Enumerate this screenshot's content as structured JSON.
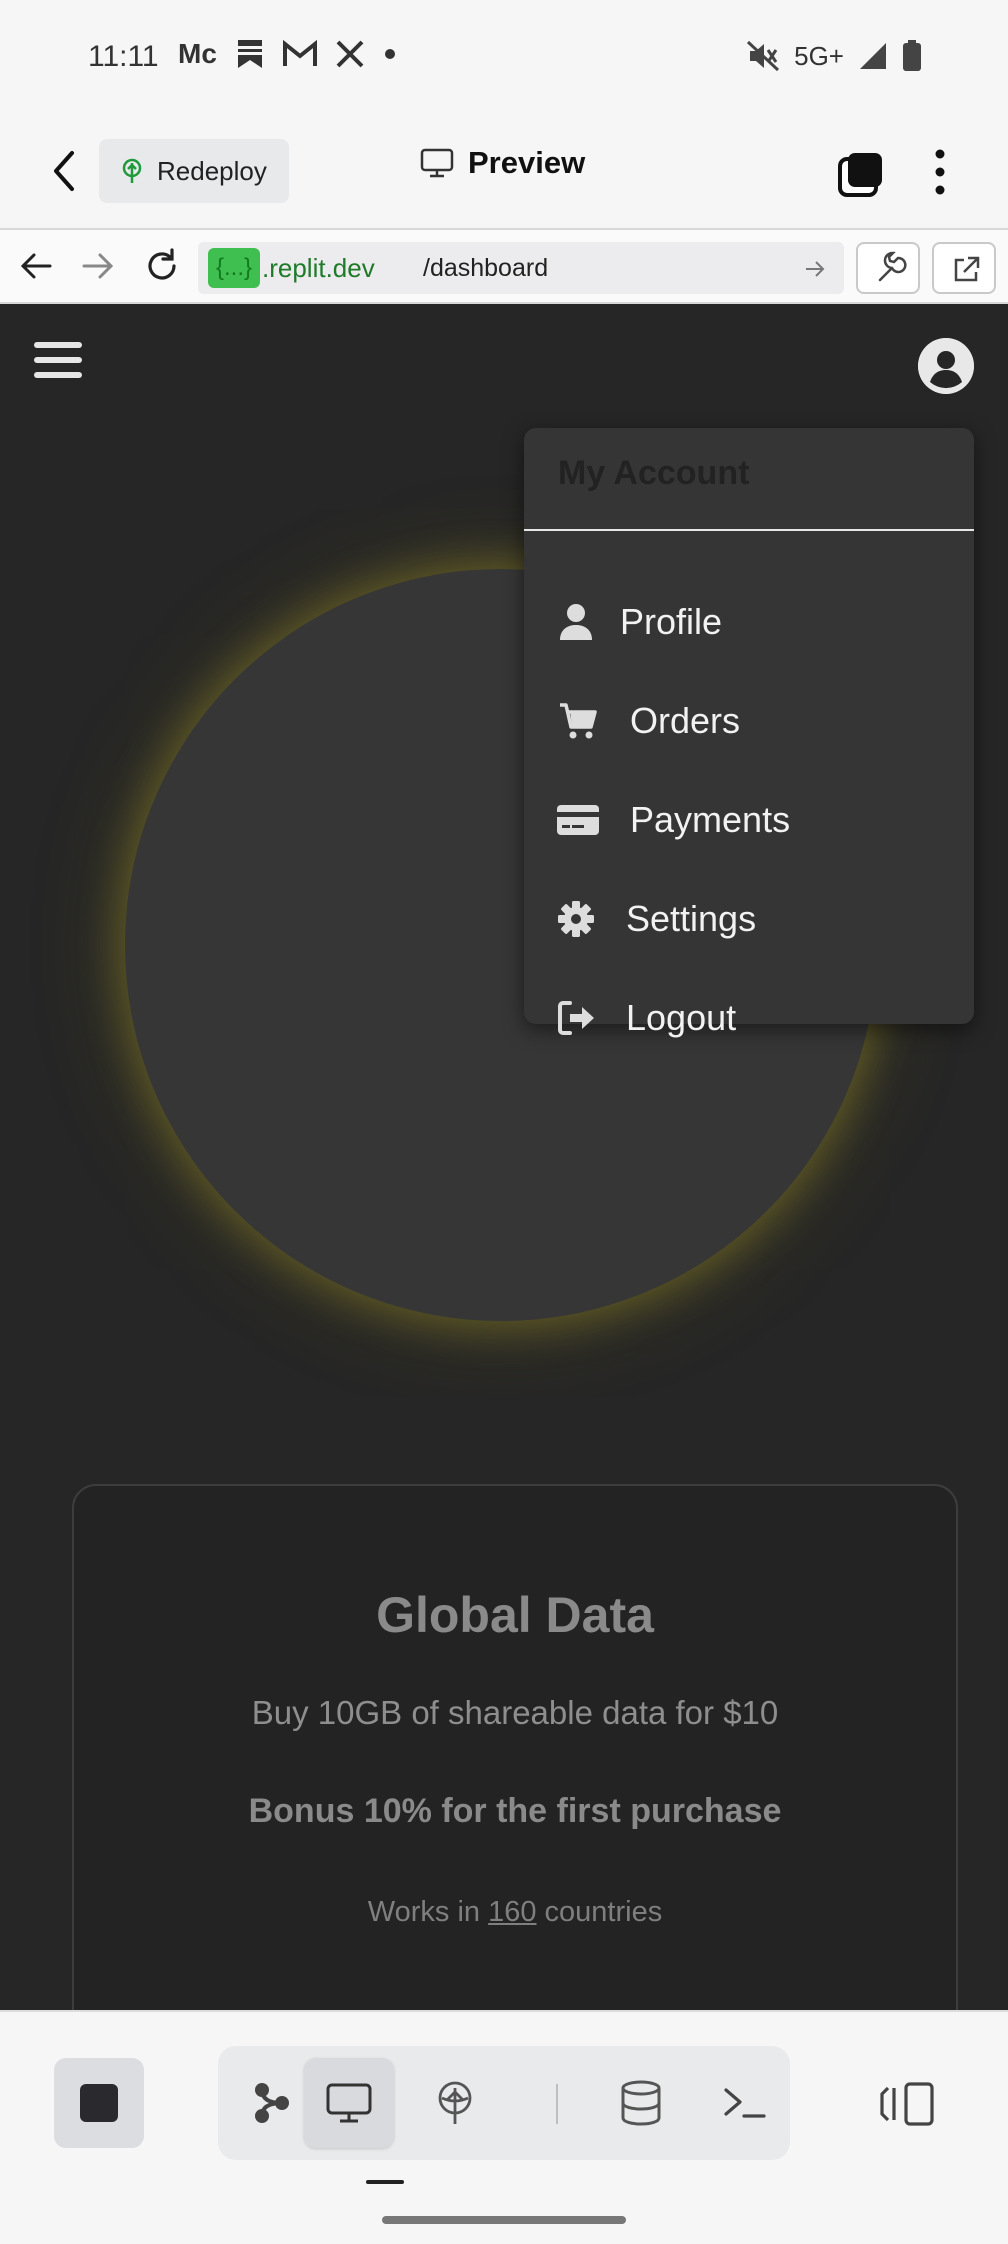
{
  "status_bar": {
    "time": "11:11",
    "left_icons": [
      "Mc",
      "bookmark-icon",
      "gmail-icon",
      "x-icon",
      "dot-icon"
    ],
    "network": "5G+"
  },
  "top_bar": {
    "redeploy_label": "Redeploy",
    "preview_label": "Preview"
  },
  "url_bar": {
    "badge": "{...}",
    "domain": ".replit.dev",
    "path": "/dashboard"
  },
  "dropdown": {
    "header": "My Account",
    "items": [
      {
        "label": "Profile",
        "icon": "user-icon"
      },
      {
        "label": "Orders",
        "icon": "cart-icon"
      },
      {
        "label": "Payments",
        "icon": "credit-card-icon"
      },
      {
        "label": "Settings",
        "icon": "gear-icon"
      },
      {
        "label": "Logout",
        "icon": "logout-icon"
      }
    ]
  },
  "card": {
    "title": "Global Data",
    "subtitle": "Buy 10GB of shareable data for $10",
    "bonus": "Bonus 10% for the first purchase",
    "works_prefix": "Works in ",
    "works_count": "160",
    "works_suffix": " countries"
  },
  "bottom_nav": {
    "tabs": [
      "git-icon",
      "preview-monitor-icon",
      "deploy-icon",
      "database-icon",
      "shell-icon"
    ],
    "active_tab": "preview-monitor-icon"
  },
  "colors": {
    "app_bg": "#262626",
    "menu_bg": "#353535",
    "url_green": "#1f7a2a",
    "badge_green": "#3fbf4f"
  }
}
